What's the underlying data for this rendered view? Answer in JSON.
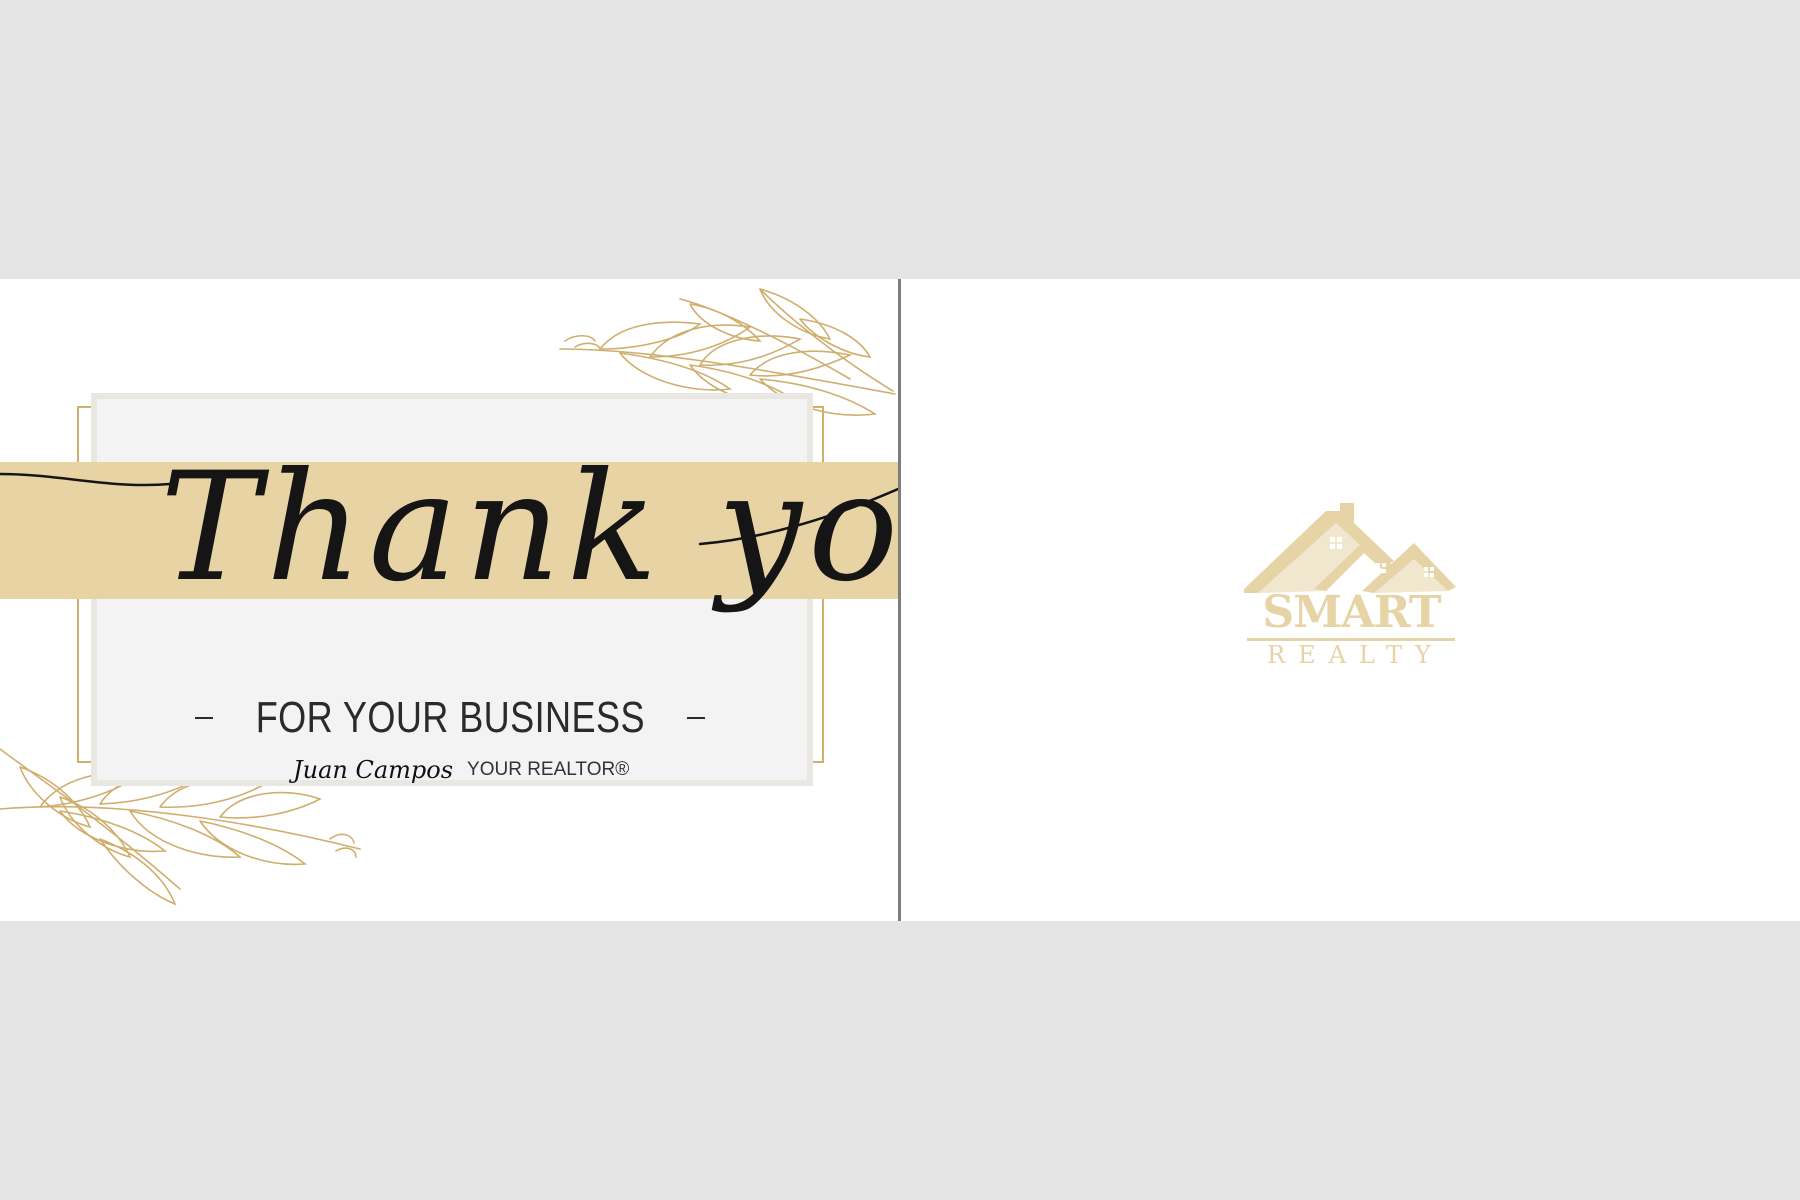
{
  "card_front": {
    "headline": "Thank you",
    "subheadline": "FOR YOUR BUSINESS",
    "realtor_name": "Juan Campos",
    "realtor_title": "YOUR REALTOR®"
  },
  "card_back": {
    "logo": {
      "brand_line1": "SMART",
      "brand_line2": "REALTY",
      "icon": "house-rooftops-icon"
    }
  },
  "colors": {
    "page_background": "#e4e4e4",
    "card_background": "#ffffff",
    "gold_band": "#e8d3a5",
    "gold_leaf": "#cfae6e",
    "logo_gold": "#e6d3a6",
    "fold_line": "#7d7d7d",
    "ink": "#151515"
  }
}
